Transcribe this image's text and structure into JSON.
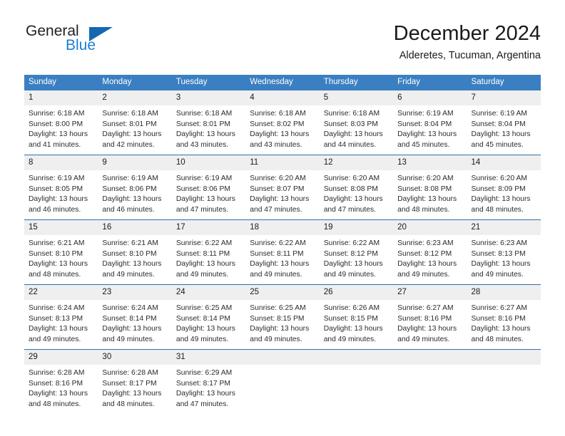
{
  "brand": {
    "name_dark": "General",
    "name_light": "Blue",
    "triangle_icon": "triangle-icon",
    "accent_dark": "#1568b0",
    "accent_light": "#1a7fd4"
  },
  "header": {
    "title": "December 2024",
    "location": "Alderetes, Tucuman, Argentina"
  },
  "theme": {
    "header_band": "#3a7fc1",
    "row_divider": "#2f6fb0",
    "daynum_band": "#efefef"
  },
  "weekdays": [
    "Sunday",
    "Monday",
    "Tuesday",
    "Wednesday",
    "Thursday",
    "Friday",
    "Saturday"
  ],
  "weeks": [
    [
      {
        "day": "1",
        "sunrise": "Sunrise: 6:18 AM",
        "sunset": "Sunset: 8:00 PM",
        "daylight_1": "Daylight: 13 hours",
        "daylight_2": "and 41 minutes."
      },
      {
        "day": "2",
        "sunrise": "Sunrise: 6:18 AM",
        "sunset": "Sunset: 8:01 PM",
        "daylight_1": "Daylight: 13 hours",
        "daylight_2": "and 42 minutes."
      },
      {
        "day": "3",
        "sunrise": "Sunrise: 6:18 AM",
        "sunset": "Sunset: 8:01 PM",
        "daylight_1": "Daylight: 13 hours",
        "daylight_2": "and 43 minutes."
      },
      {
        "day": "4",
        "sunrise": "Sunrise: 6:18 AM",
        "sunset": "Sunset: 8:02 PM",
        "daylight_1": "Daylight: 13 hours",
        "daylight_2": "and 43 minutes."
      },
      {
        "day": "5",
        "sunrise": "Sunrise: 6:18 AM",
        "sunset": "Sunset: 8:03 PM",
        "daylight_1": "Daylight: 13 hours",
        "daylight_2": "and 44 minutes."
      },
      {
        "day": "6",
        "sunrise": "Sunrise: 6:19 AM",
        "sunset": "Sunset: 8:04 PM",
        "daylight_1": "Daylight: 13 hours",
        "daylight_2": "and 45 minutes."
      },
      {
        "day": "7",
        "sunrise": "Sunrise: 6:19 AM",
        "sunset": "Sunset: 8:04 PM",
        "daylight_1": "Daylight: 13 hours",
        "daylight_2": "and 45 minutes."
      }
    ],
    [
      {
        "day": "8",
        "sunrise": "Sunrise: 6:19 AM",
        "sunset": "Sunset: 8:05 PM",
        "daylight_1": "Daylight: 13 hours",
        "daylight_2": "and 46 minutes."
      },
      {
        "day": "9",
        "sunrise": "Sunrise: 6:19 AM",
        "sunset": "Sunset: 8:06 PM",
        "daylight_1": "Daylight: 13 hours",
        "daylight_2": "and 46 minutes."
      },
      {
        "day": "10",
        "sunrise": "Sunrise: 6:19 AM",
        "sunset": "Sunset: 8:06 PM",
        "daylight_1": "Daylight: 13 hours",
        "daylight_2": "and 47 minutes."
      },
      {
        "day": "11",
        "sunrise": "Sunrise: 6:20 AM",
        "sunset": "Sunset: 8:07 PM",
        "daylight_1": "Daylight: 13 hours",
        "daylight_2": "and 47 minutes."
      },
      {
        "day": "12",
        "sunrise": "Sunrise: 6:20 AM",
        "sunset": "Sunset: 8:08 PM",
        "daylight_1": "Daylight: 13 hours",
        "daylight_2": "and 47 minutes."
      },
      {
        "day": "13",
        "sunrise": "Sunrise: 6:20 AM",
        "sunset": "Sunset: 8:08 PM",
        "daylight_1": "Daylight: 13 hours",
        "daylight_2": "and 48 minutes."
      },
      {
        "day": "14",
        "sunrise": "Sunrise: 6:20 AM",
        "sunset": "Sunset: 8:09 PM",
        "daylight_1": "Daylight: 13 hours",
        "daylight_2": "and 48 minutes."
      }
    ],
    [
      {
        "day": "15",
        "sunrise": "Sunrise: 6:21 AM",
        "sunset": "Sunset: 8:10 PM",
        "daylight_1": "Daylight: 13 hours",
        "daylight_2": "and 48 minutes."
      },
      {
        "day": "16",
        "sunrise": "Sunrise: 6:21 AM",
        "sunset": "Sunset: 8:10 PM",
        "daylight_1": "Daylight: 13 hours",
        "daylight_2": "and 49 minutes."
      },
      {
        "day": "17",
        "sunrise": "Sunrise: 6:22 AM",
        "sunset": "Sunset: 8:11 PM",
        "daylight_1": "Daylight: 13 hours",
        "daylight_2": "and 49 minutes."
      },
      {
        "day": "18",
        "sunrise": "Sunrise: 6:22 AM",
        "sunset": "Sunset: 8:11 PM",
        "daylight_1": "Daylight: 13 hours",
        "daylight_2": "and 49 minutes."
      },
      {
        "day": "19",
        "sunrise": "Sunrise: 6:22 AM",
        "sunset": "Sunset: 8:12 PM",
        "daylight_1": "Daylight: 13 hours",
        "daylight_2": "and 49 minutes."
      },
      {
        "day": "20",
        "sunrise": "Sunrise: 6:23 AM",
        "sunset": "Sunset: 8:12 PM",
        "daylight_1": "Daylight: 13 hours",
        "daylight_2": "and 49 minutes."
      },
      {
        "day": "21",
        "sunrise": "Sunrise: 6:23 AM",
        "sunset": "Sunset: 8:13 PM",
        "daylight_1": "Daylight: 13 hours",
        "daylight_2": "and 49 minutes."
      }
    ],
    [
      {
        "day": "22",
        "sunrise": "Sunrise: 6:24 AM",
        "sunset": "Sunset: 8:13 PM",
        "daylight_1": "Daylight: 13 hours",
        "daylight_2": "and 49 minutes."
      },
      {
        "day": "23",
        "sunrise": "Sunrise: 6:24 AM",
        "sunset": "Sunset: 8:14 PM",
        "daylight_1": "Daylight: 13 hours",
        "daylight_2": "and 49 minutes."
      },
      {
        "day": "24",
        "sunrise": "Sunrise: 6:25 AM",
        "sunset": "Sunset: 8:14 PM",
        "daylight_1": "Daylight: 13 hours",
        "daylight_2": "and 49 minutes."
      },
      {
        "day": "25",
        "sunrise": "Sunrise: 6:25 AM",
        "sunset": "Sunset: 8:15 PM",
        "daylight_1": "Daylight: 13 hours",
        "daylight_2": "and 49 minutes."
      },
      {
        "day": "26",
        "sunrise": "Sunrise: 6:26 AM",
        "sunset": "Sunset: 8:15 PM",
        "daylight_1": "Daylight: 13 hours",
        "daylight_2": "and 49 minutes."
      },
      {
        "day": "27",
        "sunrise": "Sunrise: 6:27 AM",
        "sunset": "Sunset: 8:16 PM",
        "daylight_1": "Daylight: 13 hours",
        "daylight_2": "and 49 minutes."
      },
      {
        "day": "28",
        "sunrise": "Sunrise: 6:27 AM",
        "sunset": "Sunset: 8:16 PM",
        "daylight_1": "Daylight: 13 hours",
        "daylight_2": "and 48 minutes."
      }
    ],
    [
      {
        "day": "29",
        "sunrise": "Sunrise: 6:28 AM",
        "sunset": "Sunset: 8:16 PM",
        "daylight_1": "Daylight: 13 hours",
        "daylight_2": "and 48 minutes."
      },
      {
        "day": "30",
        "sunrise": "Sunrise: 6:28 AM",
        "sunset": "Sunset: 8:17 PM",
        "daylight_1": "Daylight: 13 hours",
        "daylight_2": "and 48 minutes."
      },
      {
        "day": "31",
        "sunrise": "Sunrise: 6:29 AM",
        "sunset": "Sunset: 8:17 PM",
        "daylight_1": "Daylight: 13 hours",
        "daylight_2": "and 47 minutes."
      },
      {
        "day": "",
        "sunrise": "",
        "sunset": "",
        "daylight_1": "",
        "daylight_2": ""
      },
      {
        "day": "",
        "sunrise": "",
        "sunset": "",
        "daylight_1": "",
        "daylight_2": ""
      },
      {
        "day": "",
        "sunrise": "",
        "sunset": "",
        "daylight_1": "",
        "daylight_2": ""
      },
      {
        "day": "",
        "sunrise": "",
        "sunset": "",
        "daylight_1": "",
        "daylight_2": ""
      }
    ]
  ]
}
